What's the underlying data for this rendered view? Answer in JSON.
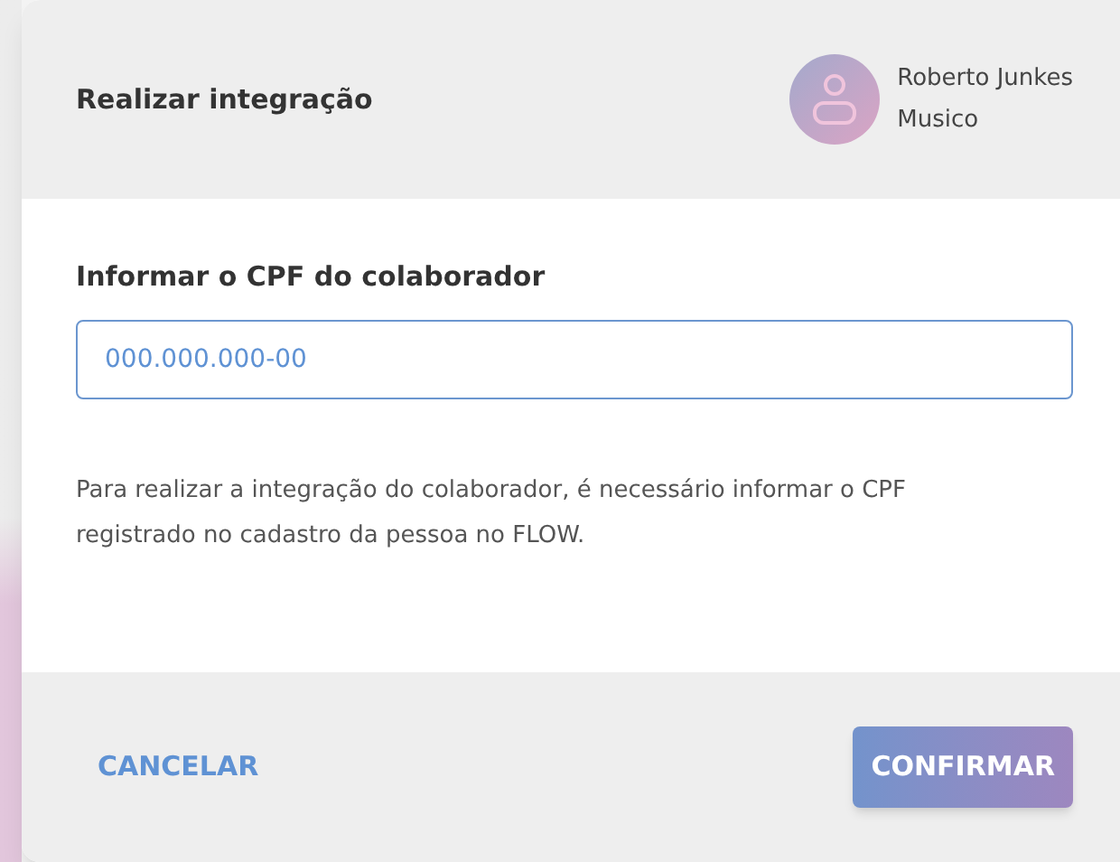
{
  "dialog": {
    "title": "Realizar integração",
    "user": {
      "name": "Roberto Junkes",
      "role": "Musico"
    },
    "field": {
      "label": "Informar o CPF do colaborador",
      "placeholder": "000.000.000-00"
    },
    "help_text": "Para realizar a integração do colaborador, é necessário informar o CPF registrado no cadastro da pessoa no FLOW.",
    "buttons": [
      {
        "kind": "text",
        "label": "CANCELAR"
      },
      {
        "kind": "primary",
        "label": "CONFIRMAR"
      }
    ]
  }
}
